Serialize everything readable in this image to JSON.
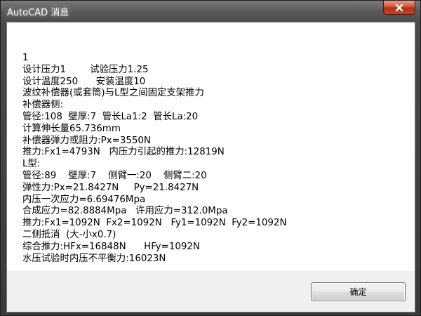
{
  "window": {
    "title": "AutoCAD 消息"
  },
  "message": {
    "lines": [
      "1",
      "设计压力1        试验压力1.25",
      "设计温度250      安装温度10",
      "波纹补偿器(或套筒)与L型之间固定支架推力",
      "补偿器侧:",
      "管径:108  壁厚:7  管长La1:2  管长La:20",
      "计算伸长量65.736mm",
      "补偿器弹力或阻力:Px=3550N",
      "推力:Fx1=4793N   内压力引起的推力:12819N",
      "L型:",
      "管径:89    壁厚:7    侧臂一:20    侧臂二:20",
      "弹性力:Px=21.8427N     Py=21.8427N",
      "内压一次应力=6.69476Mpa",
      "合成应力=82.8884Mpa   许用应力=312.0Mpa",
      "推力:Fx1=1092N  Fx2=1092N   Fy1=1092N  Fy2=1092N",
      "二侧抵消  (大-小x0.7)",
      "综合推力:HFx=16848N      HFy=1092N",
      "水压试验时内压不平衡力:16023N"
    ]
  },
  "buttons": {
    "ok_label": "确定"
  },
  "icons": {
    "close": "close-icon"
  },
  "colors": {
    "close_button": "#c9462a",
    "title_bar": "#5b5b5b"
  }
}
